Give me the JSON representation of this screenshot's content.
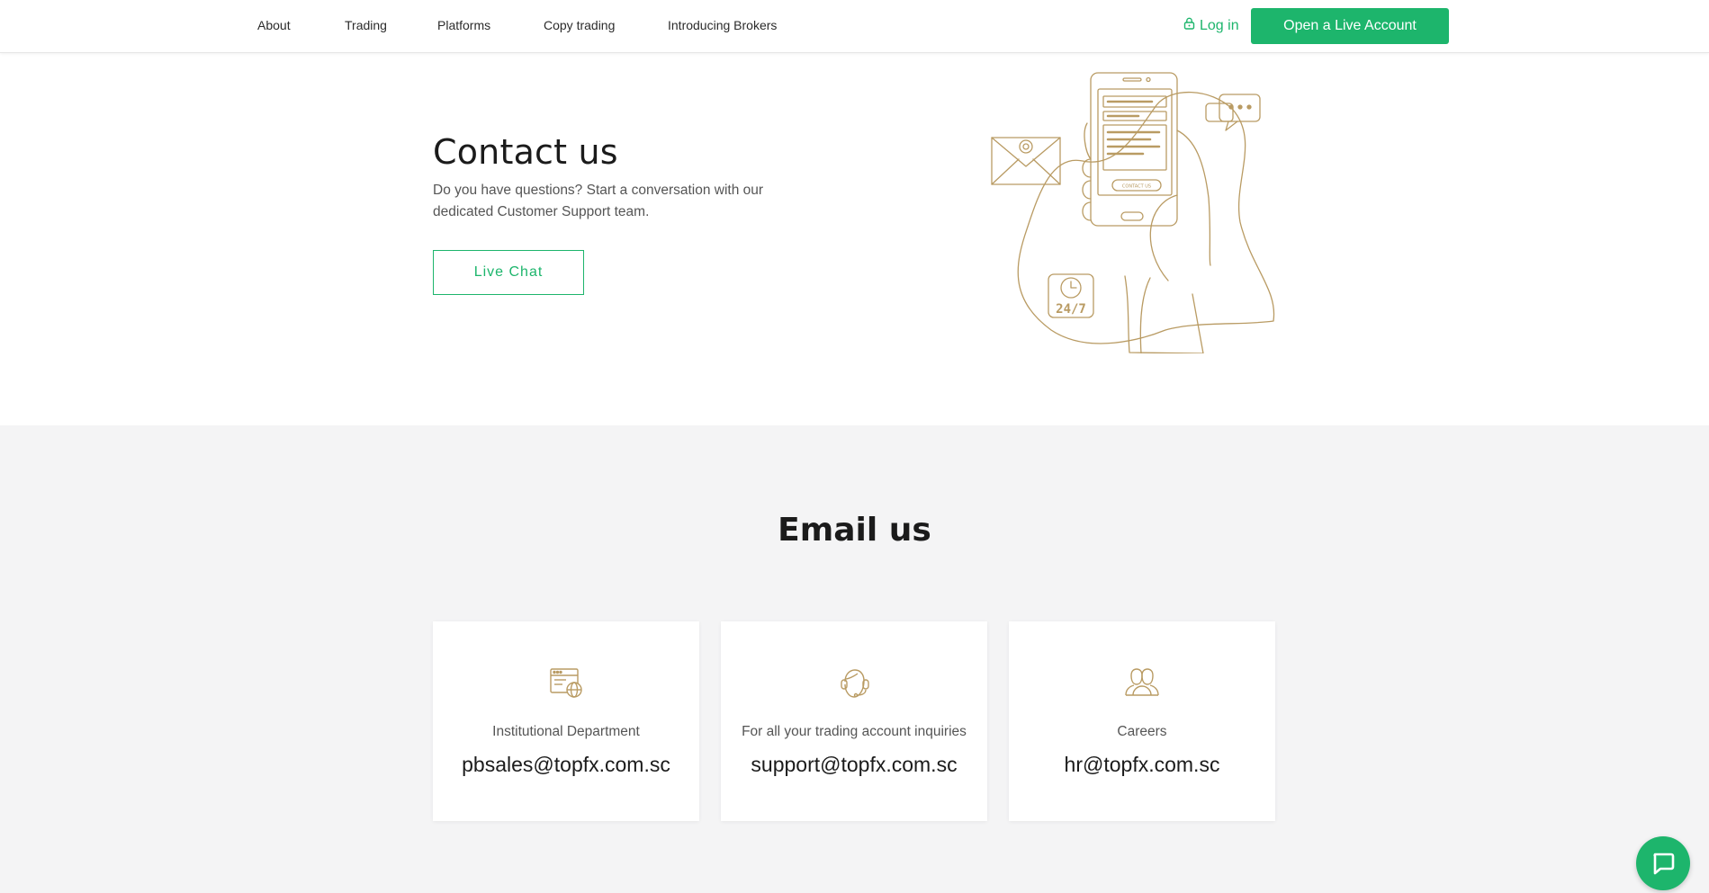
{
  "header": {
    "nav": [
      {
        "label": "About"
      },
      {
        "label": "Trading"
      },
      {
        "label": "Platforms"
      },
      {
        "label": "Copy trading"
      },
      {
        "label": "Introducing Brokers"
      }
    ],
    "login_label": "Log in",
    "cta_label": "Open a Live Account"
  },
  "hero": {
    "title": "Contact us",
    "description": "Do you have questions? Start a conversation with our dedicated Customer Support team.",
    "live_chat_label": "Live Chat",
    "illustration_texts": {
      "button": "CONTACT US",
      "badge": "24/7"
    }
  },
  "email_section": {
    "title": "Email us",
    "cards": [
      {
        "label": "Institutional Department",
        "email": "pbsales@topfx.com.sc",
        "icon": "web-globe-icon"
      },
      {
        "label": "For all your trading account inquiries",
        "email": "support@topfx.com.sc",
        "icon": "headset-support-icon"
      },
      {
        "label": "Careers",
        "email": "hr@topfx.com.sc",
        "icon": "people-icon"
      }
    ]
  },
  "colors": {
    "accent": "#1db56c",
    "illustration": "#b99b63",
    "section_bg": "#f4f4f5"
  }
}
